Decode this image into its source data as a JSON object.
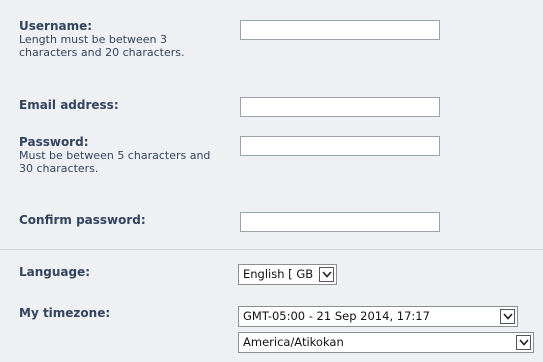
{
  "form": {
    "username": {
      "label": "Username:",
      "hint": "Length must be between 3 characters and 20 characters.",
      "value": ""
    },
    "email": {
      "label": "Email address:",
      "value": ""
    },
    "password": {
      "label": "Password:",
      "hint": "Must be between 5 characters and 30 characters.",
      "value": ""
    },
    "confirm_password": {
      "label": "Confirm password:",
      "value": ""
    },
    "language": {
      "label": "Language:",
      "selected": "English [ GB ]"
    },
    "timezone": {
      "label": "My timezone:",
      "offset_selected": "GMT-05:00 - 21 Sep 2014, 17:17",
      "zone_selected": "America/Atikokan"
    }
  },
  "icons": {
    "dropdown": "chevron-down-icon"
  },
  "colors": {
    "background": "#eef0f3",
    "label_text": "#33445e"
  }
}
